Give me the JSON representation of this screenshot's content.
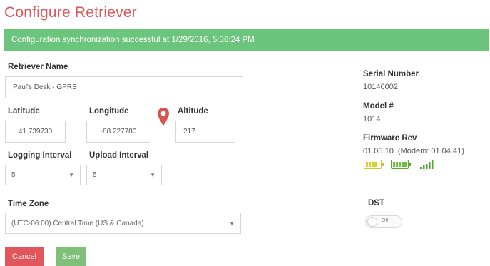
{
  "page": {
    "title": "Configure Retriever",
    "alert": "Configuration synchronization successful at 1/29/2016, 5:36:24 PM"
  },
  "form": {
    "retriever_name_label": "Retriever Name",
    "retriever_name_value": "Paul's Desk - GPRS",
    "latitude_label": "Latitude",
    "latitude_value": "41.739730",
    "longitude_label": "Longitude",
    "longitude_value": "-88.227780",
    "altitude_label": "Altitude",
    "altitude_value": "217",
    "logging_interval_label": "Logging Interval",
    "logging_interval_value": "5",
    "upload_interval_label": "Upload Interval",
    "upload_interval_value": "5",
    "time_zone_label": "Time Zone",
    "time_zone_value": "(UTC-06:00) Central Time (US & Canada)",
    "dst_label": "DST",
    "dst_state": "Off"
  },
  "info": {
    "serial_label": "Serial Number",
    "serial_value": "10140002",
    "model_label": "Model #",
    "model_value": "1014",
    "firmware_label": "Firmware Rev",
    "firmware_value": "01.05.10  (Modem: 01.04.41)"
  },
  "status_icons": {
    "battery_icon": "battery-icon",
    "battery_level": 0.75,
    "battery_color": "#d6d62a",
    "battery2_icon": "battery-icon",
    "battery2_level": 1.0,
    "battery2_color": "#6cc23a",
    "signal_icon": "signal-icon",
    "signal_bars": 5,
    "signal_color": "#4cae2e"
  },
  "buttons": {
    "cancel_label": "Cancel",
    "save_label": "Save"
  },
  "colors": {
    "title": "#e0565b",
    "alert_bg": "#6cc57c",
    "cancel_bg": "#e0565b",
    "save_bg": "#7fbf7a",
    "pin": "#d9534f"
  }
}
